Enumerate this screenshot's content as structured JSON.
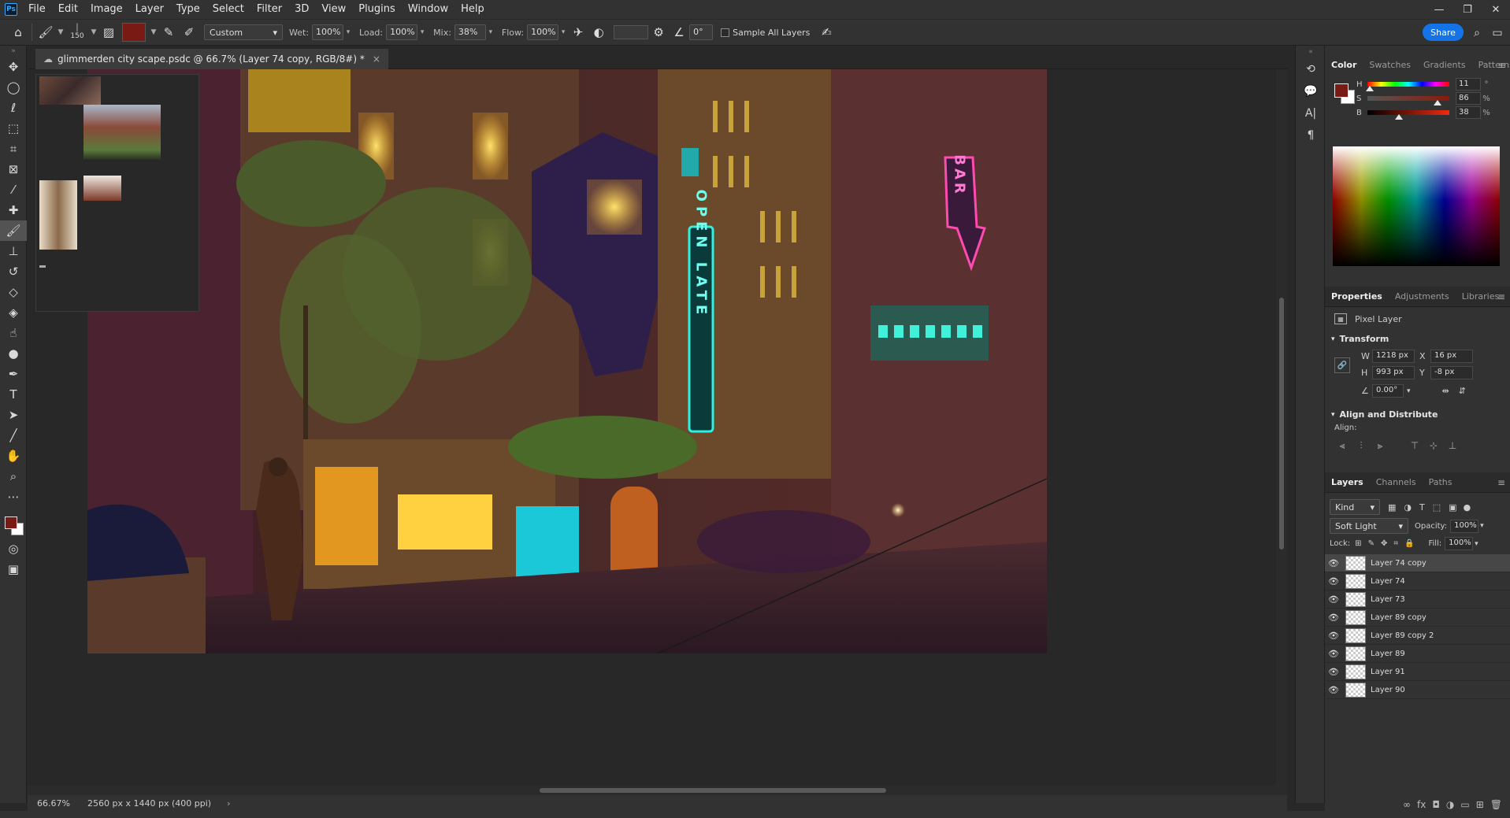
{
  "app": {
    "logo": "Ps",
    "menu": [
      "File",
      "Edit",
      "Image",
      "Layer",
      "Type",
      "Select",
      "Filter",
      "3D",
      "View",
      "Plugins",
      "Window",
      "Help"
    ],
    "window_controls": [
      "—",
      "❐",
      "✕"
    ]
  },
  "options": {
    "brush_size": "150",
    "preset": "Custom",
    "wet_label": "Wet:",
    "wet_value": "100%",
    "load_label": "Load:",
    "load_value": "100%",
    "mix_label": "Mix:",
    "mix_value": "38%",
    "flow_label": "Flow:",
    "flow_value": "100%",
    "angle_value": "0°",
    "sample_all_layers": "Sample All Layers",
    "share": "Share",
    "foreground_color": "#7a1a14"
  },
  "document": {
    "tab_title": "glimmerden city scape.psdc @ 66.7% (Layer 74 copy, RGB/8#) *",
    "zoom": "66.67%",
    "size": "2560 px x 1440 px (400 ppi)",
    "signs": {
      "open_late": "OPEN LATE",
      "bar": "BAR"
    }
  },
  "color_panel": {
    "tabs": [
      "Color",
      "Swatches",
      "Gradients",
      "Patterns"
    ],
    "active_tab": "Color",
    "h_label": "H",
    "h_value": "11",
    "h_unit": "°",
    "h_fraction": 0.03,
    "s_label": "S",
    "s_value": "86",
    "s_unit": "%",
    "s_fraction": 0.86,
    "b_label": "B",
    "b_value": "38",
    "b_unit": "%",
    "b_fraction": 0.38
  },
  "properties_panel": {
    "tabs": [
      "Properties",
      "Adjustments",
      "Libraries"
    ],
    "active_tab": "Properties",
    "kind": "Pixel Layer",
    "transform_label": "Transform",
    "w_label": "W",
    "w_value": "1218 px",
    "h_label": "H",
    "h_value": "993 px",
    "x_label": "X",
    "x_value": "16 px",
    "y_label": "Y",
    "y_value": "-8 px",
    "angle_value": "0.00°",
    "align_label": "Align and Distribute",
    "align_sub": "Align:"
  },
  "layers_panel": {
    "tabs": [
      "Layers",
      "Channels",
      "Paths"
    ],
    "active_tab": "Layers",
    "filter_kind": "Kind",
    "blend_mode": "Soft Light",
    "opacity_label": "Opacity:",
    "opacity_value": "100%",
    "lock_label": "Lock:",
    "fill_label": "Fill:",
    "fill_value": "100%",
    "layers": [
      {
        "name": "Layer 74 copy",
        "selected": true
      },
      {
        "name": "Layer 74",
        "selected": false
      },
      {
        "name": "Layer 73",
        "selected": false
      },
      {
        "name": "Layer 89 copy",
        "selected": false
      },
      {
        "name": "Layer 89 copy 2",
        "selected": false
      },
      {
        "name": "Layer 89",
        "selected": false
      },
      {
        "name": "Layer 91",
        "selected": false
      },
      {
        "name": "Layer 90",
        "selected": false
      }
    ]
  }
}
